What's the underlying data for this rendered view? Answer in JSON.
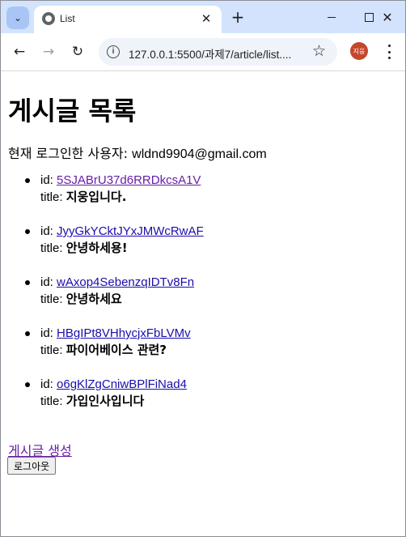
{
  "browser": {
    "tab_title": "List",
    "url": "127.0.0.1:5500/과제7/article/list....",
    "profile_initials": "지웅"
  },
  "page": {
    "title": "게시글 목록",
    "current_user_label": "현재 로그인한 사용자: ",
    "current_user_email": "wldnd9904@gmail.com",
    "id_label": "id: ",
    "title_label": "title: ",
    "articles": [
      {
        "id": "5SJABrU37d6RRDkcsA1V",
        "title": "지웅입니다."
      },
      {
        "id": "JyyGkYCktJYxJMWcRwAF",
        "title": "안녕하세용!"
      },
      {
        "id": "wAxop4SebenzqIDTv8Fn",
        "title": "안녕하세요"
      },
      {
        "id": "HBgIPt8VHhycjxFbLVMv",
        "title": "파이어베이스 관련?"
      },
      {
        "id": "o6gKlZgCniwBPlFiNad4",
        "title": "가입인사입니다"
      }
    ],
    "create_link": "게시글 생성",
    "logout_button": "로그아웃"
  },
  "colors": {
    "tab_strip": "#d3e3fd",
    "link": "#1a0dab",
    "visited_link": "#681da8",
    "avatar": "#c5462c"
  }
}
